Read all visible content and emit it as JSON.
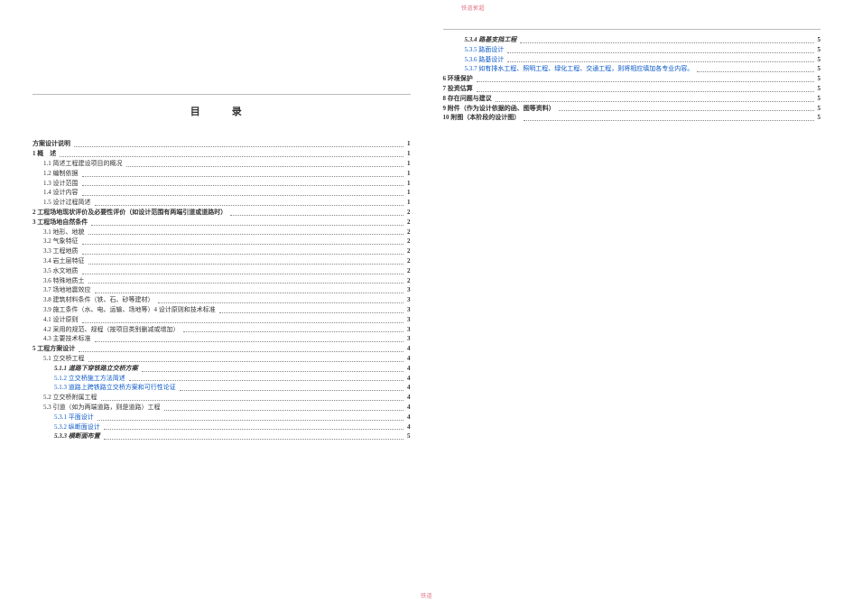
{
  "doc": {
    "top_tag": "铁道郭超",
    "bottom_tag": "铁道",
    "title": "目　录",
    "left": [
      {
        "label": "方案设计说明",
        "page": "1",
        "indent": 0,
        "bold": true
      },
      {
        "label": "1 概　述",
        "page": "1",
        "indent": 0,
        "bold": true
      },
      {
        "label": "1.1 简述工程建设项目的概况",
        "page": "1",
        "indent": 1
      },
      {
        "label": "1.2 编制依据",
        "page": "1",
        "indent": 1
      },
      {
        "label": "1.3 设计范围",
        "page": "1",
        "indent": 1
      },
      {
        "label": "1.4 设计内容",
        "page": "1",
        "indent": 1
      },
      {
        "label": "1.5 设计过程简述",
        "page": "1",
        "indent": 1
      },
      {
        "label": "2 工程场地现状评价及必要性评价（如设计范围有两端引道或道路时）",
        "page": "2",
        "indent": 0,
        "bold": true
      },
      {
        "label": "3 工程场地自然条件",
        "page": "2",
        "indent": 0,
        "bold": true
      },
      {
        "label": "3.1 地形、地貌",
        "page": "2",
        "indent": 1
      },
      {
        "label": "3.2 气象特征",
        "page": "2",
        "indent": 1
      },
      {
        "label": "3.3 工程地质",
        "page": "2",
        "indent": 1
      },
      {
        "label": "3.4 岩土层特征",
        "page": "2",
        "indent": 1
      },
      {
        "label": "3.5 水文地质",
        "page": "2",
        "indent": 1
      },
      {
        "label": "3.6 特殊地质土",
        "page": "2",
        "indent": 1
      },
      {
        "label": "3.7 场地地震效应",
        "page": "3",
        "indent": 1
      },
      {
        "label": "3.8 建筑材料条件（铁、石、砂等建材）",
        "page": "3",
        "indent": 1
      },
      {
        "label": "3.9 施工条件（水、电、运输、场地等）4 设计原则和技术标准",
        "page": "3",
        "indent": 1
      },
      {
        "label": "4.1 设计原则",
        "page": "3",
        "indent": 1
      },
      {
        "label": "4.2 采用的规范、规程（按项目类别删减或增加）",
        "page": "3",
        "indent": 1
      },
      {
        "label": "4.3 主要技术标准",
        "page": "3",
        "indent": 1
      },
      {
        "label": "5 工程方案设计",
        "page": "4",
        "indent": 0,
        "bold": true
      },
      {
        "label": "5.1 立交桥工程",
        "page": "4",
        "indent": 1
      },
      {
        "label": "5.1.1 道路下穿铁路立交桥方案",
        "page": "4",
        "indent": 2,
        "italic": true,
        "bold": true
      },
      {
        "label": "5.1.2 立交桥施工方法简述",
        "page": "4",
        "indent": 2,
        "blue": true
      },
      {
        "label": "5.1.3 道路上跨铁路立交桥方案和可行性论证",
        "page": "4",
        "indent": 2,
        "blue": true
      },
      {
        "label": "5.2 立交桥附属工程",
        "page": "4",
        "indent": 1
      },
      {
        "label": "5.3 引道（如为两端道路，则是道路）工程",
        "page": "4",
        "indent": 1
      },
      {
        "label": "5.3.1 平面设计",
        "page": "4",
        "indent": 2,
        "blue": true
      },
      {
        "label": "5.3.2 纵断面设计",
        "page": "4",
        "indent": 2,
        "blue": true
      },
      {
        "label": "5.3.3 横断面布置",
        "page": "5",
        "indent": 2,
        "italic": true,
        "bold": true
      }
    ],
    "right": [
      {
        "label": "5.3.4 路基支挡工程",
        "page": "5",
        "indent": 2,
        "italic": true,
        "bold": true
      },
      {
        "label": "5.3.5 路面设计",
        "page": "5",
        "indent": 2,
        "blue": true
      },
      {
        "label": "5.3.6 路基设计",
        "page": "5",
        "indent": 2,
        "blue": true
      },
      {
        "label": "5.3.7 如有排水工程、照明工程、绿化工程、交通工程，则将相应填加各专业内容。",
        "page": "5",
        "indent": 2,
        "blue": true
      },
      {
        "label": "6 环境保护",
        "page": "5",
        "indent": 0,
        "bold": true
      },
      {
        "label": "7 投资估算",
        "page": "5",
        "indent": 0,
        "bold": true
      },
      {
        "label": "8 存在问题与建议",
        "page": "5",
        "indent": 0,
        "bold": true
      },
      {
        "label": "9 附件（作为设计依据的函、图等资料）",
        "page": "5",
        "indent": 0,
        "bold": true
      },
      {
        "label": "10 附图（本阶段的设计图）",
        "page": "5",
        "indent": 0,
        "bold": true
      }
    ]
  }
}
